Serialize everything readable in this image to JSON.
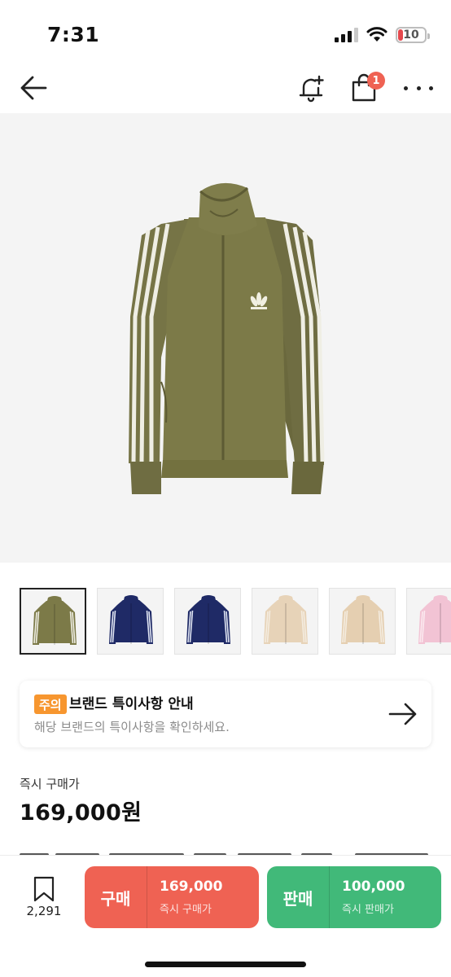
{
  "status_bar": {
    "time": "7:31",
    "battery": "10",
    "battery_color": "#e5484d"
  },
  "nav": {
    "back_icon": "arrow-left-icon",
    "alert_icon": "bell-plus-icon",
    "bag_icon": "shopping-bag-icon",
    "bag_badge": "1",
    "more_icon": "more-dots-icon"
  },
  "product": {
    "image": "olive-track-jacket",
    "thumbnails": [
      {
        "color": "#7c7a48",
        "stripe": "#efeee4",
        "active": true
      },
      {
        "color": "#1f2a66",
        "stripe": "#dfe4f2",
        "active": false
      },
      {
        "color": "#1f2a66",
        "stripe": "#dfe4f2",
        "active": false
      },
      {
        "color": "#e7d3b8",
        "stripe": "#f4ece0",
        "active": false
      },
      {
        "color": "#e5cfb1",
        "stripe": "#f4ece0",
        "active": false
      },
      {
        "color": "#f2c3d4",
        "stripe": "#fbe9ef",
        "active": false
      }
    ]
  },
  "notice": {
    "badge": "주의",
    "title": "브랜드 특이사항 안내",
    "description": "해당 브랜드의 특이사항을 확인하세요.",
    "arrow_icon": "arrow-right-icon",
    "badge_color": "#f7962f"
  },
  "price": {
    "label": "즉시 구매가",
    "value": "169,000원"
  },
  "bottom_bar": {
    "bookmark_icon": "bookmark-icon",
    "bookmark_count": "2,291",
    "buy": {
      "label": "구매",
      "price": "169,000",
      "sub": "즉시 구매가",
      "color": "#ef6253"
    },
    "sell": {
      "label": "판매",
      "price": "100,000",
      "sub": "즉시 판매가",
      "color": "#41b979"
    }
  }
}
